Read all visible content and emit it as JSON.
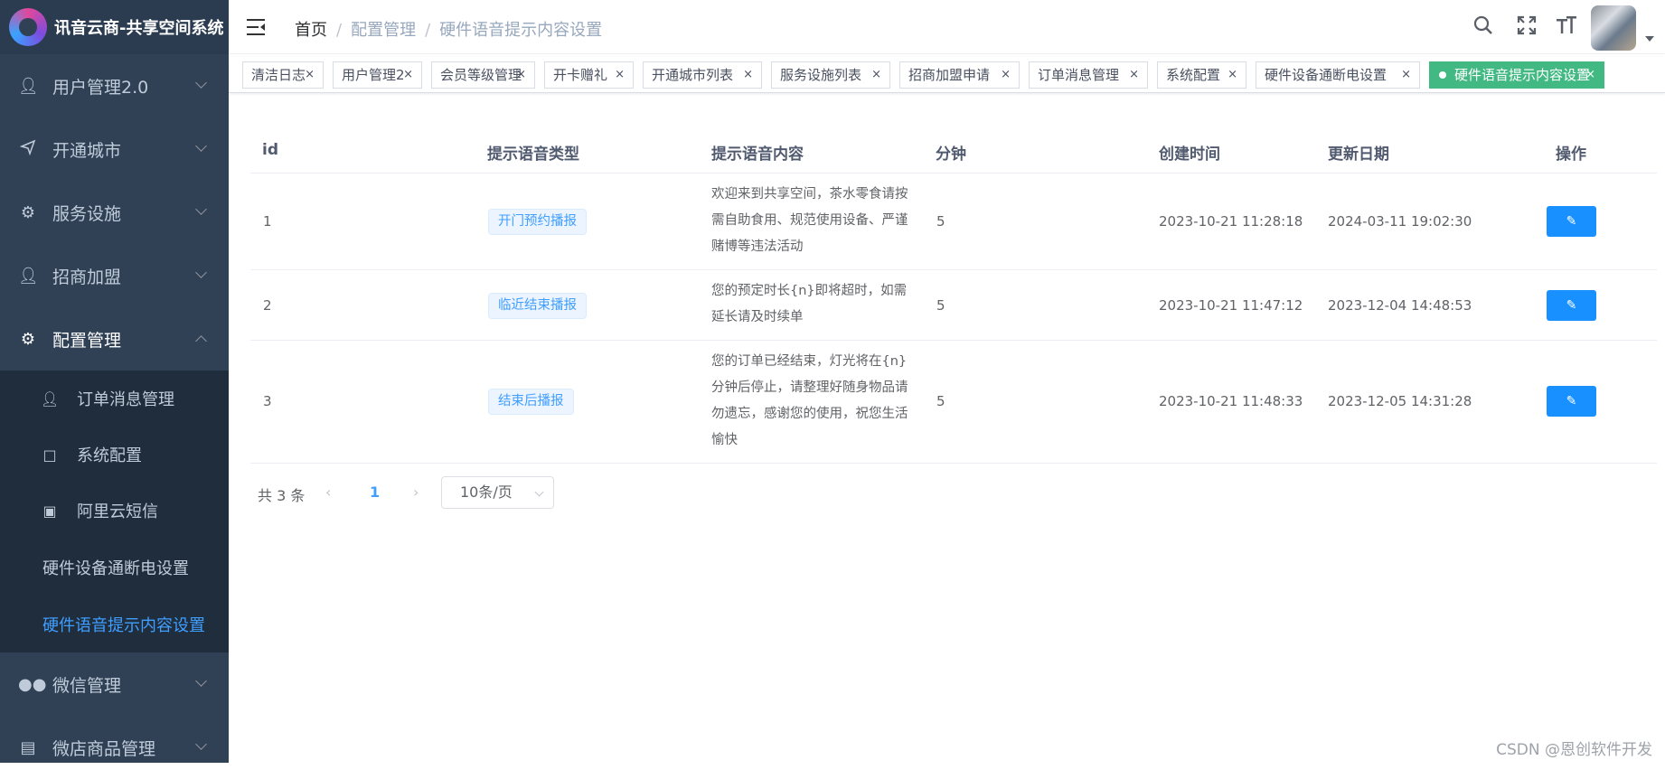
{
  "app": {
    "title": "讯音云商-共享空间系统"
  },
  "sidebar": {
    "items": [
      {
        "label": "用户管理2.0",
        "icon": "users-icon"
      },
      {
        "label": "开通城市",
        "icon": "send-icon"
      },
      {
        "label": "服务设施",
        "icon": "gear-icon"
      },
      {
        "label": "招商加盟",
        "icon": "users-icon"
      },
      {
        "label": "配置管理",
        "icon": "gear-icon"
      },
      {
        "label": "微信管理",
        "icon": "wechat-icon"
      },
      {
        "label": "微店商品管理",
        "icon": "shop-icon"
      }
    ],
    "submenu": [
      {
        "label": "订单消息管理",
        "icon": "users-icon"
      },
      {
        "label": "系统配置",
        "icon": "shield-icon"
      },
      {
        "label": "阿里云短信",
        "icon": "briefcase-icon"
      },
      {
        "label": "硬件设备通断电设置"
      },
      {
        "label": "硬件语音提示内容设置"
      }
    ]
  },
  "breadcrumb": {
    "home": "首页",
    "level1": "配置管理",
    "current": "硬件语音提示内容设置"
  },
  "tags": [
    "清洁日志",
    "用户管理2",
    "会员等级管理",
    "开卡赠礼",
    "开通城市列表",
    "服务设施列表",
    "招商加盟申请",
    "订单消息管理",
    "系统配置",
    "硬件设备通断电设置",
    "硬件语音提示内容设置"
  ],
  "table": {
    "headers": {
      "id": "id",
      "type": "提示语音类型",
      "content": "提示语音内容",
      "minutes": "分钟",
      "created": "创建时间",
      "updated": "更新日期",
      "action": "操作"
    },
    "rows": [
      {
        "id": "1",
        "type": "开门预约播报",
        "content": "欢迎来到共享空间，茶水零食请按需自助食用、规范使用设备、严谨赌博等违法活动",
        "minutes": "5",
        "created": "2023-10-21 11:28:18",
        "updated": "2024-03-11 19:02:30"
      },
      {
        "id": "2",
        "type": "临近结束播报",
        "content": "您的预定时长{n}即将超时，如需延长请及时续单",
        "minutes": "5",
        "created": "2023-10-21 11:47:12",
        "updated": "2023-12-04 14:48:53"
      },
      {
        "id": "3",
        "type": "结束后播报",
        "content": "您的订单已经结束，灯光将在{n}分钟后停止，请整理好随身物品请勿遗忘，感谢您的使用，祝您生活愉快",
        "minutes": "5",
        "created": "2023-10-21 11:48:33",
        "updated": "2023-12-05 14:31:28"
      }
    ]
  },
  "pagination": {
    "total": "共 3 条",
    "current": "1",
    "size": "10条/页"
  },
  "watermark": "CSDN @恩创软件开发",
  "colors": {
    "sidebar_bg": "#304156",
    "submenu_bg": "#1f2d3d",
    "accent": "#409eff",
    "active_tag": "#42b983",
    "button": "#1890ff"
  }
}
